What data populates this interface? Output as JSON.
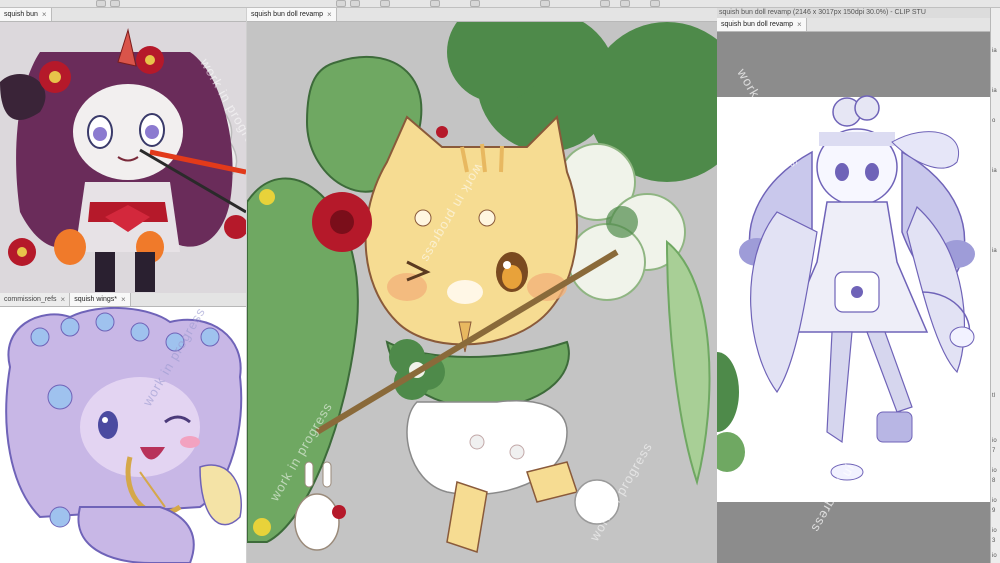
{
  "windows": {
    "top_left": {
      "tab_label": "squish bun",
      "close": "×"
    },
    "bottom_left": {
      "tabs": [
        {
          "label": "commission_refs",
          "close": "×"
        },
        {
          "label": "squish wings*",
          "close": "×"
        }
      ]
    },
    "center": {
      "tab_label": "squish bun doll revamp",
      "close": "×"
    },
    "right": {
      "title_bar": "squish bun doll revamp (2146 x 3017px 150dpi 30.0%) - CLIP STU",
      "tab_label": "squish bun doll revamp",
      "close": "×"
    }
  },
  "watermark": {
    "text_lines": [
      "work in progress",
      "work in progress",
      "ssəɹɓoɹd ui ʞɹoʍ",
      "ssəɹɓoɹd ui ʞɹoʍ"
    ]
  },
  "right_panel": {
    "labels": [
      "ia",
      "ia",
      "o",
      "ia",
      "ia",
      "tl",
      "io",
      "7",
      "io",
      "8",
      "io",
      "9",
      "io",
      "3",
      "io"
    ]
  },
  "colors": {
    "bg_gray": "#c4c4c4",
    "leaf_dark": "#4e8a4a",
    "leaf_mid": "#6fa862",
    "leaf_light": "#a8cf96",
    "cat_fill": "#f6dc92",
    "cat_stripe": "#e8b860",
    "flower_red": "#b5192a",
    "lavender": "#c8b7e6",
    "purple_line": "#6f63b8",
    "oni_hair": "#6a2c5a",
    "rose_blue": "#9fc2ee"
  }
}
